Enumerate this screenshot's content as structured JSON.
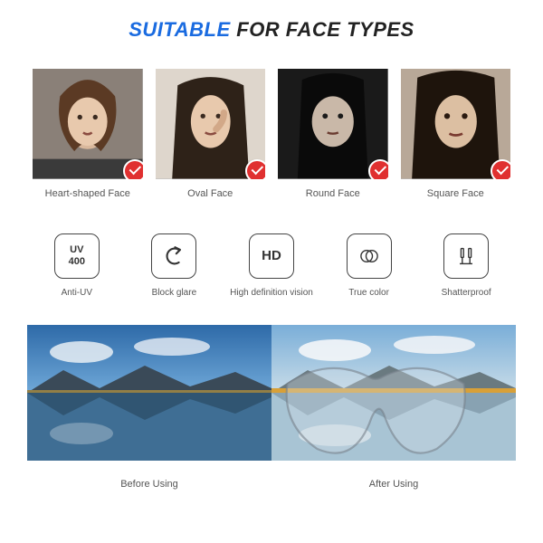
{
  "title": {
    "prefix": "SUITABLE",
    "rest": "FOR FACE TYPES"
  },
  "faces": [
    {
      "label": "Heart-shaped Face"
    },
    {
      "label": "Oval Face"
    },
    {
      "label": "Round Face"
    },
    {
      "label": "Square Face"
    }
  ],
  "features": [
    {
      "icon": "uv400",
      "label": "Anti-UV",
      "text": "UV\n400"
    },
    {
      "icon": "block-glare",
      "label": "Block glare"
    },
    {
      "icon": "hd",
      "label": "High definition vision",
      "text": "HD"
    },
    {
      "icon": "true-color",
      "label": "True color"
    },
    {
      "icon": "shatterproof",
      "label": "Shatterproof"
    }
  ],
  "comparison": {
    "before": "Before Using",
    "after": "After Using"
  }
}
